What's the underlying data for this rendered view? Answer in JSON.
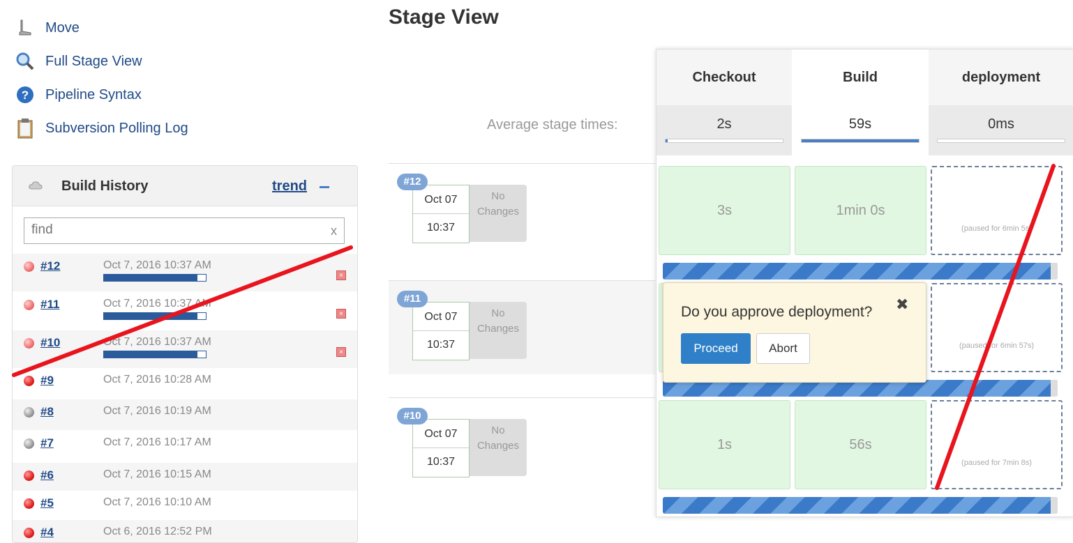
{
  "sidebar": {
    "items": [
      {
        "label": "Move",
        "icon": "move-icon"
      },
      {
        "label": "Full Stage View",
        "icon": "magnifier-icon"
      },
      {
        "label": "Pipeline Syntax",
        "icon": "help-icon"
      },
      {
        "label": "Subversion Polling Log",
        "icon": "clipboard-icon"
      }
    ]
  },
  "build_history": {
    "title": "Build History",
    "trend_label": "trend",
    "search_placeholder": "find",
    "search_clear": "x",
    "builds": [
      {
        "number": "#12",
        "date": "Oct 7, 2016 10:37 AM",
        "status": "running",
        "progress": 0.92
      },
      {
        "number": "#11",
        "date": "Oct 7, 2016 10:37 AM",
        "status": "running",
        "progress": 0.92
      },
      {
        "number": "#10",
        "date": "Oct 7, 2016 10:37 AM",
        "status": "running",
        "progress": 0.92
      },
      {
        "number": "#9",
        "date": "Oct 7, 2016 10:28 AM",
        "status": "failed"
      },
      {
        "number": "#8",
        "date": "Oct 7, 2016 10:19 AM",
        "status": "aborted"
      },
      {
        "number": "#7",
        "date": "Oct 7, 2016 10:17 AM",
        "status": "aborted"
      },
      {
        "number": "#6",
        "date": "Oct 7, 2016 10:15 AM",
        "status": "failed"
      },
      {
        "number": "#5",
        "date": "Oct 7, 2016 10:10 AM",
        "status": "failed"
      },
      {
        "number": "#4",
        "date": "Oct 6, 2016 12:52 PM",
        "status": "failed"
      }
    ]
  },
  "stage_view": {
    "title": "Stage View",
    "avg_label": "Average stage times:",
    "stages": [
      {
        "name": "Checkout",
        "avg": "2s",
        "avg_fraction": 0.02
      },
      {
        "name": "Build",
        "avg": "59s",
        "avg_fraction": 1.0
      },
      {
        "name": "deployment",
        "avg": "0ms",
        "avg_fraction": 0.0
      }
    ],
    "runs": [
      {
        "badge": "#12",
        "date": "Oct 07",
        "time": "10:37",
        "changes": "No Changes",
        "cells": [
          "3s",
          "1min 0s",
          "(paused for 6min 5s)"
        ]
      },
      {
        "badge": "#11",
        "date": "Oct 07",
        "time": "10:37",
        "changes": "No Changes",
        "cells": [
          "",
          "",
          "(paused for 6min 57s)"
        ]
      },
      {
        "badge": "#10",
        "date": "Oct 07",
        "time": "10:37",
        "changes": "No Changes",
        "cells": [
          "1s",
          "56s",
          "(paused for 7min 8s)"
        ]
      }
    ]
  },
  "approval": {
    "question": "Do you approve deployment?",
    "close": "✖",
    "proceed_label": "Proceed",
    "abort_label": "Abort"
  },
  "colors": {
    "link": "#204a87",
    "success_cell": "#e2f7e2",
    "progress_blue": "#2c5b9c",
    "annotation_red": "#e8141e"
  }
}
